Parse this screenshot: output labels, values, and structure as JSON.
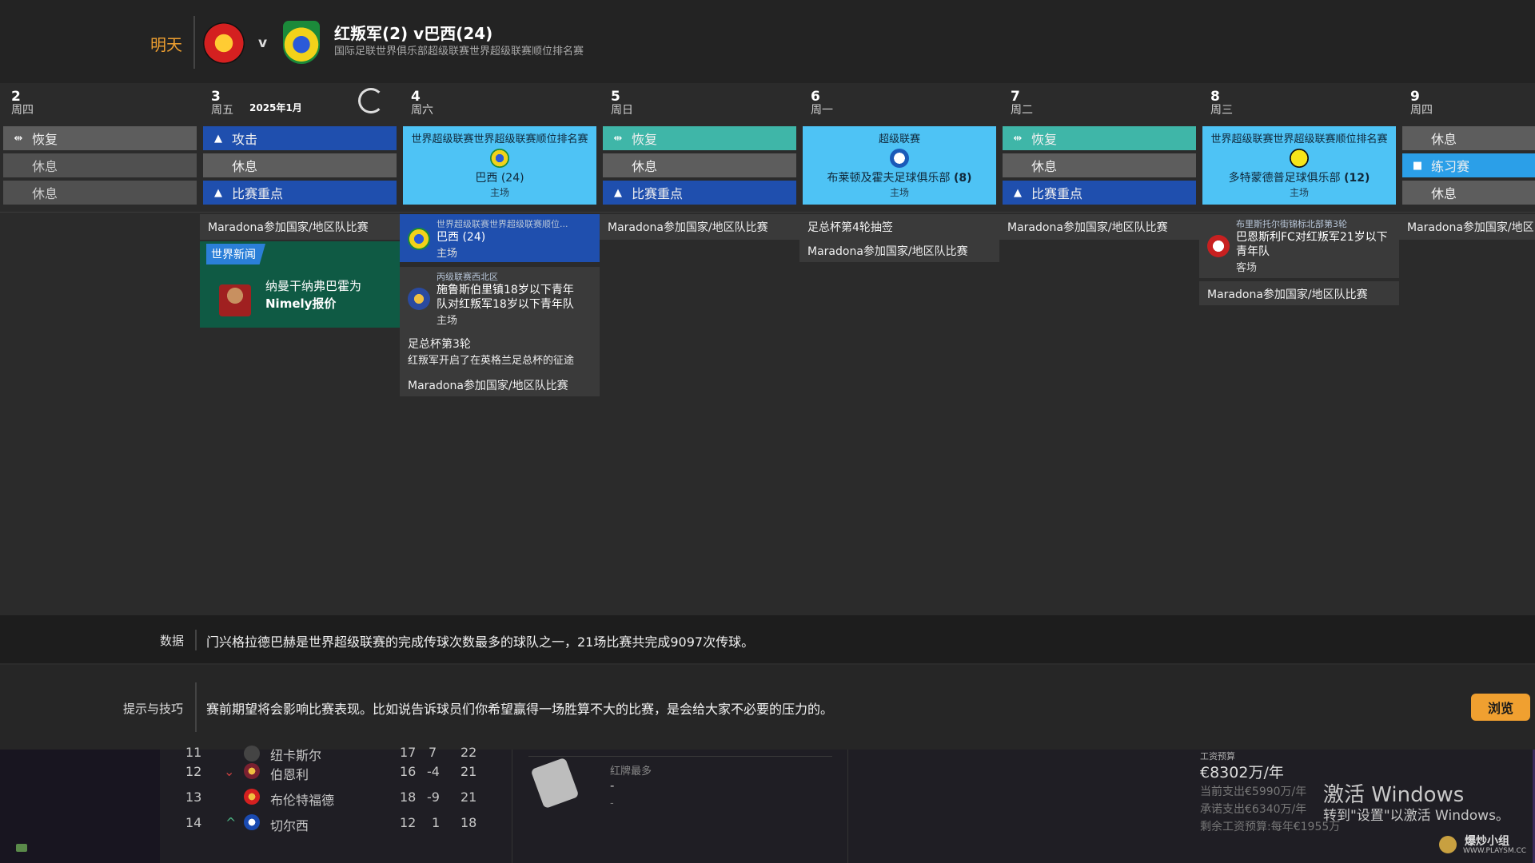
{
  "header": {
    "when": "明天",
    "versus": "v",
    "title": "红叛军(2) v巴西(24)",
    "subtitle": "国际足联世界俱乐部超级联赛世界超级联赛顺位排名赛"
  },
  "calendar": {
    "month": "2025年1月",
    "days": [
      {
        "num": "2",
        "week": "周四"
      },
      {
        "num": "3",
        "week": "周五"
      },
      {
        "num": "4",
        "week": "周六"
      },
      {
        "num": "5",
        "week": "周日"
      },
      {
        "num": "6",
        "week": "周一"
      },
      {
        "num": "7",
        "week": "周二"
      },
      {
        "num": "8",
        "week": "周三"
      },
      {
        "num": "9",
        "week": "周四"
      }
    ],
    "d2": {
      "s1": "恢复",
      "s2": "休息",
      "s3": "休息"
    },
    "d3": {
      "s1": "攻击",
      "s2": "休息",
      "s3": "比赛重点",
      "note1": "Maradona参加国家/地区队比赛",
      "news_tag": "世界新闻",
      "news_line1": "纳曼干纳弗巴霍为",
      "news_line2": "Nimely报价"
    },
    "d4": {
      "comp": "世界超级联赛世界超级联赛顺位排名赛",
      "team": "巴西 (24)",
      "venue": "主场",
      "ev1_small": "世界超级联赛世界超级联赛顺位...",
      "ev1_team": "巴西 (24)",
      "ev1_venue": "主场",
      "ev2_small": "丙级联赛西北区",
      "ev2_line1": "施鲁斯伯里镇18岁以下青年",
      "ev2_line2": "队对红叛军18岁以下青年队",
      "ev2_venue": "主场",
      "cup_title": "足总杯第3轮",
      "cup_desc": "红叛军开启了在英格兰足总杯的征途",
      "note": "Maradona参加国家/地区队比赛"
    },
    "d5": {
      "s1": "恢复",
      "s2": "休息",
      "s3": "比赛重点",
      "note": "Maradona参加国家/地区队比赛"
    },
    "d6": {
      "comp": "超级联赛",
      "team": "布莱顿及霍夫足球俱乐部",
      "rank": "(8)",
      "venue": "主场",
      "note1": "足总杯第4轮抽签",
      "note2": "Maradona参加国家/地区队比赛"
    },
    "d7": {
      "s1": "恢复",
      "s2": "休息",
      "s3": "比赛重点",
      "note": "Maradona参加国家/地区队比赛"
    },
    "d8": {
      "comp": "世界超级联赛世界超级联赛顺位排名赛",
      "team": "多特蒙德普足球俱乐部",
      "rank": "(12)",
      "venue": "主场",
      "ev_small": "布里斯托尔街锦标北部第3轮",
      "ev_line1": "巴恩斯利FC对红叛军21岁以下",
      "ev_line2": "青年队",
      "ev_venue": "客场",
      "note": "Maradona参加国家/地区队比赛"
    },
    "d9": {
      "s1": "休息",
      "s2": "练习赛",
      "s3": "休息",
      "note": "Maradona参加国家/地区队比"
    }
  },
  "info": {
    "data_label": "数据",
    "data_text": "门兴格拉德巴赫是世界超级联赛的完成传球次数最多的球队之一，21场比赛共完成9097次传球。",
    "tips_label": "提示与技巧",
    "tips_text": "赛前期望将会影响比赛表现。比如说告诉球员们你希望赢得一场胜算不大的比赛，是会给大家不必要的压力的。",
    "browse": "浏览"
  },
  "table": {
    "rows": [
      {
        "pos": "11",
        "name": "纽卡斯尔",
        "p": "17",
        "gd": "7",
        "pts": "22"
      },
      {
        "pos": "12",
        "trend": "⌄",
        "name": "伯恩利",
        "p": "16",
        "gd": "-4",
        "pts": "21"
      },
      {
        "pos": "13",
        "name": "布伦特福德",
        "p": "18",
        "gd": "-9",
        "pts": "21"
      },
      {
        "pos": "14",
        "trend": "^",
        "name": "切尔西",
        "p": "12",
        "gd": "1",
        "pts": "18"
      }
    ]
  },
  "cards": {
    "label": "红牌最多",
    "v1": "-",
    "v2": "-"
  },
  "wages": {
    "label": "工资预算",
    "value": "€8302万/年",
    "line1": "当前支出€5990万/年",
    "line2": "承诺支出€6340万/年",
    "line3": "剩余工资预算:每年€1955万"
  },
  "windows": {
    "line1": "激活 Windows",
    "line2": "转到\"设置\"以激活 Windows。"
  },
  "watermark": {
    "main": "爆炒小组",
    "url": "WWW.PLAYSM.CC"
  },
  "colors": {
    "accent": "#f0a030",
    "match_card": "#4ec3f5",
    "blue_slot": "#1f4fae",
    "teal_slot": "#3fb6a8",
    "news_green": "#0f5a44"
  }
}
